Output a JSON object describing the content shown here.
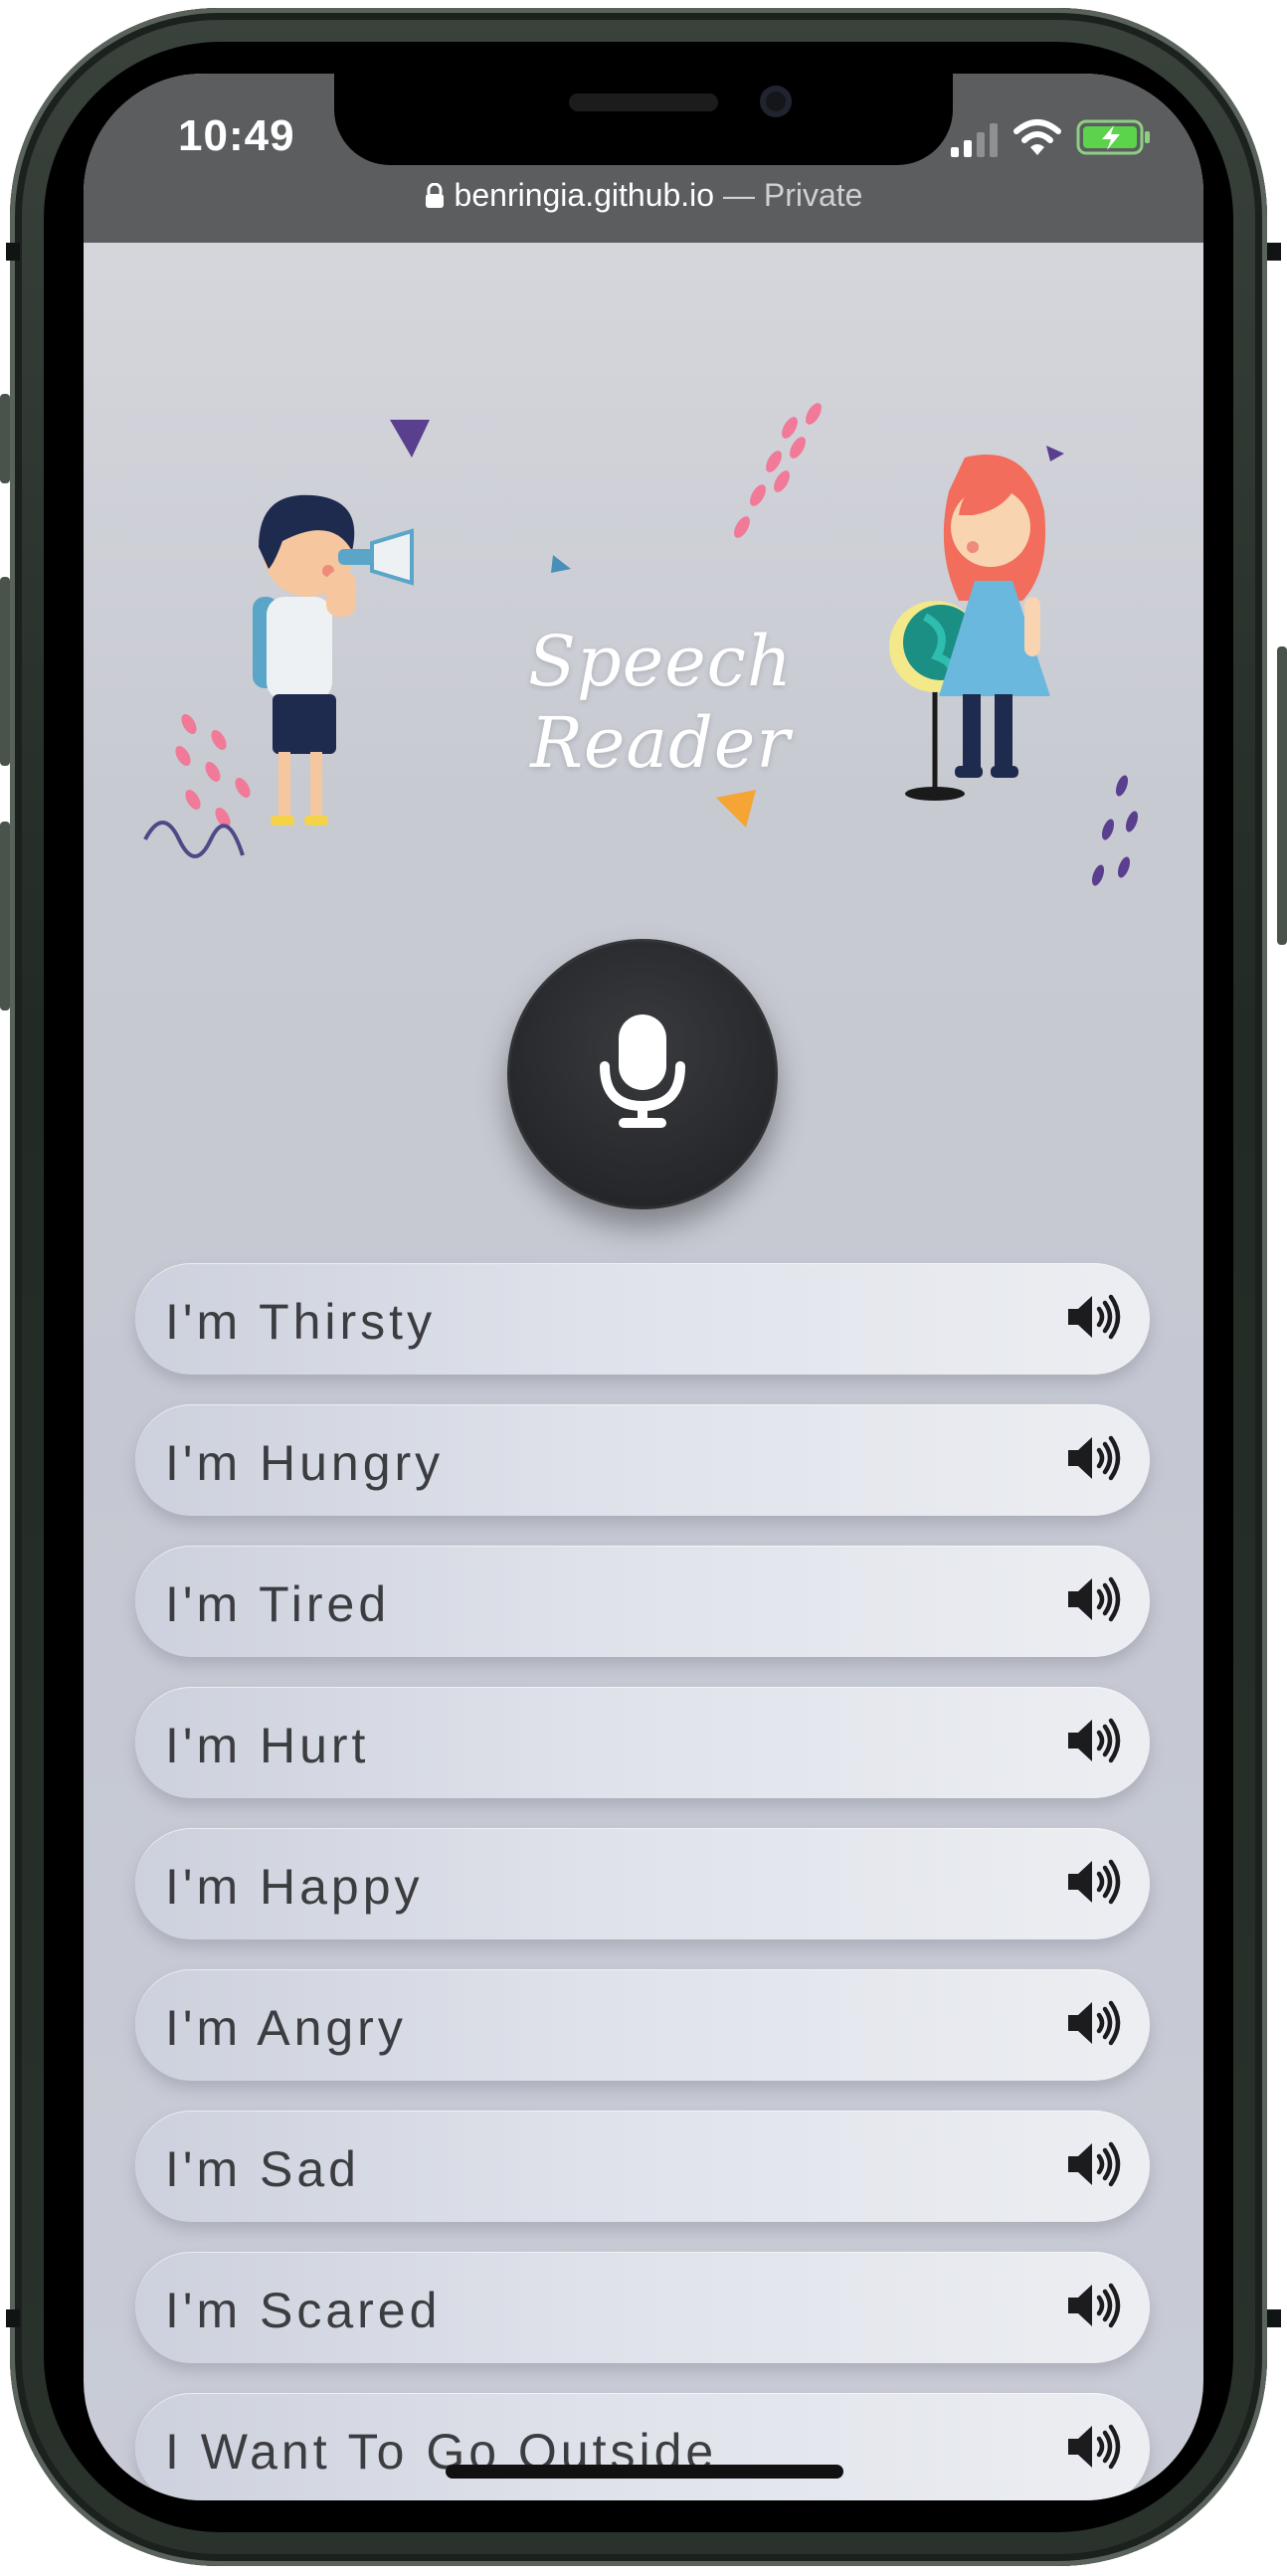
{
  "status_bar": {
    "time": "10:49"
  },
  "browser": {
    "domain": "benringia.github.io",
    "separator": " — ",
    "mode": "Private"
  },
  "app": {
    "title": "Speech Reader"
  },
  "phrases": [
    {
      "label": "I'm Thirsty"
    },
    {
      "label": "I'm Hungry"
    },
    {
      "label": "I'm Tired"
    },
    {
      "label": "I'm Hurt"
    },
    {
      "label": "I'm Happy"
    },
    {
      "label": "I'm Angry"
    },
    {
      "label": "I'm Sad"
    },
    {
      "label": "I'm Scared"
    },
    {
      "label": "I Want To Go Outside"
    }
  ],
  "icons": {
    "microphone": "microphone-icon",
    "speaker": "speaker-volume-icon",
    "lock": "lock-icon",
    "signal": "cellular-signal-icon",
    "wifi": "wifi-icon",
    "battery": "battery-charging-icon"
  },
  "colors": {
    "mic_button": "#2a2b2e",
    "phrase_text": "#3c3d40",
    "battery_fill": "#5bd34a",
    "status_bar_bg": "#5b5d5f"
  }
}
